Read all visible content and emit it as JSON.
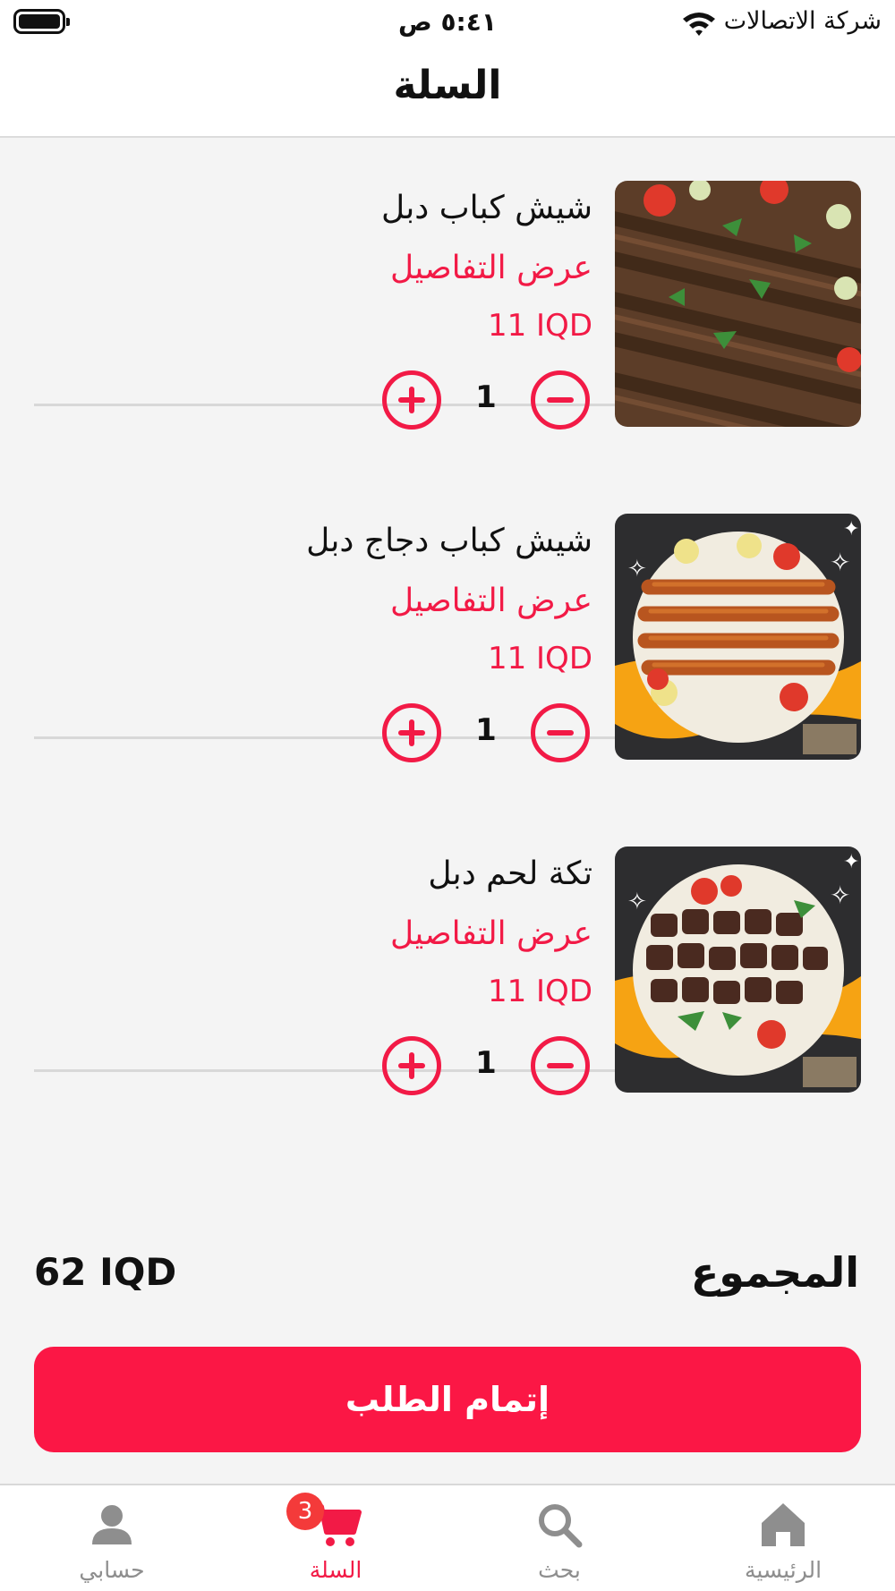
{
  "status_bar": {
    "time": "٥:٤١ ص",
    "carrier": "شركة الاتصالات",
    "wifi_icon": "wifi-icon",
    "battery_icon": "battery-icon"
  },
  "header": {
    "title": "السلة"
  },
  "cart": {
    "items": [
      {
        "name": "شيش كباب دبل",
        "details_label": "عرض التفاصيل",
        "price": "11 IQD",
        "quantity": "1"
      },
      {
        "name": "شيش كباب دجاج دبل",
        "details_label": "عرض التفاصيل",
        "price": "11 IQD",
        "quantity": "1"
      },
      {
        "name": "تكة لحم دبل",
        "details_label": "عرض التفاصيل",
        "price": "11 IQD",
        "quantity": "1"
      }
    ]
  },
  "summary": {
    "total_label": "المجموع",
    "total_value": "62 IQD"
  },
  "checkout": {
    "label": "إتمام الطلب"
  },
  "tab_bar": {
    "tabs": [
      {
        "label": "الرئيسية",
        "icon": "home-icon"
      },
      {
        "label": "بحث",
        "icon": "search-icon"
      },
      {
        "label": "السلة",
        "icon": "cart-icon",
        "badge": "3",
        "active": true
      },
      {
        "label": "حسابي",
        "icon": "user-icon"
      }
    ]
  },
  "colors": {
    "accent": "#f21a46",
    "checkout_button": "#fb1745",
    "badge": "#f43a3a",
    "inactive_tab": "#8e8e8e"
  }
}
